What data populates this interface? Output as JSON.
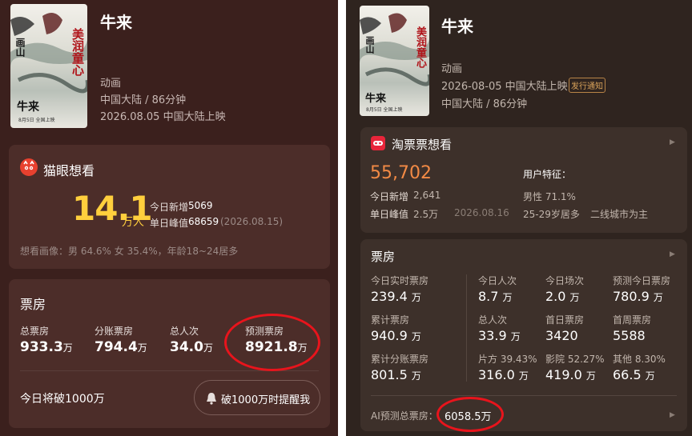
{
  "left": {
    "title": "牛来",
    "poster_text": {
      "main": "美润童心",
      "side": "画山",
      "name": "牛来",
      "foot": "8月5日 全国上映"
    },
    "genre": "动画",
    "region_duration": "中国大陆 / 86分钟",
    "release": "2026.08.05 中国大陆上映",
    "want": {
      "brand": "猫眼想看",
      "count": "14.1",
      "unit": "万人",
      "today_label": "今日新增",
      "today_value": "5069",
      "peak_label": "单日峰值",
      "peak_value": "68659",
      "peak_date": "(2026.08.15)",
      "portrait": "想看画像：男 64.6% 女 35.4%，年龄18~24居多"
    },
    "box": {
      "title": "票房",
      "stats": [
        {
          "label": "总票房",
          "value": "933.3",
          "unit": "万"
        },
        {
          "label": "分账票房",
          "value": "794.4",
          "unit": "万"
        },
        {
          "label": "总人次",
          "value": "34.0",
          "unit": "万"
        },
        {
          "label": "预测票房",
          "value": "8921.8",
          "unit": "万"
        }
      ],
      "milestone": "今日将破1000万",
      "remind_button": "破1000万时提醒我"
    }
  },
  "right": {
    "title": "牛来",
    "poster_text": {
      "main": "美润童心",
      "side": "画山",
      "name": "牛来",
      "foot": "8月5日 全国上映"
    },
    "genre": "动画",
    "release": "2026-08-05 中国大陆上映",
    "release_badge": "发行通知",
    "region_duration": "中国大陆 / 86分钟",
    "want": {
      "brand": "淘票票想看",
      "count": "55,702",
      "today_label": "今日新增",
      "today_value": "2,641",
      "peak_label": "单日峰值",
      "peak_value": "2.5万",
      "peak_date": "2026.08.16",
      "feature_title": "用户特征：",
      "gender": "男性 71.1%",
      "age": "25-29岁居多",
      "city": "二线城市为主"
    },
    "box": {
      "title": "票房",
      "grid": [
        {
          "label": "今日实时票房",
          "value": "239.4",
          "unit": "万"
        },
        {
          "label": "今日人次",
          "value": "8.7",
          "unit": "万"
        },
        {
          "label": "今日场次",
          "value": "2.0",
          "unit": "万"
        },
        {
          "label": "预测今日票房",
          "value": "780.9",
          "unit": "万"
        },
        {
          "label": "累计票房",
          "value": "940.9",
          "unit": "万"
        },
        {
          "label": "总人次",
          "value": "33.9",
          "unit": "万"
        },
        {
          "label": "首日票房",
          "value": "3420",
          "unit": ""
        },
        {
          "label": "首周票房",
          "value": "5588",
          "unit": ""
        },
        {
          "label": "累计分账票房",
          "value": "801.5",
          "unit": "万"
        },
        {
          "label": "片方 39.43%",
          "value": "316.0",
          "unit": "万"
        },
        {
          "label": "影院 52.27%",
          "value": "419.0",
          "unit": "万"
        },
        {
          "label": "其他 8.30%",
          "value": "66.5",
          "unit": "万"
        }
      ],
      "ai_label": "AI预测总票房：",
      "ai_value": "6058.5万"
    }
  }
}
